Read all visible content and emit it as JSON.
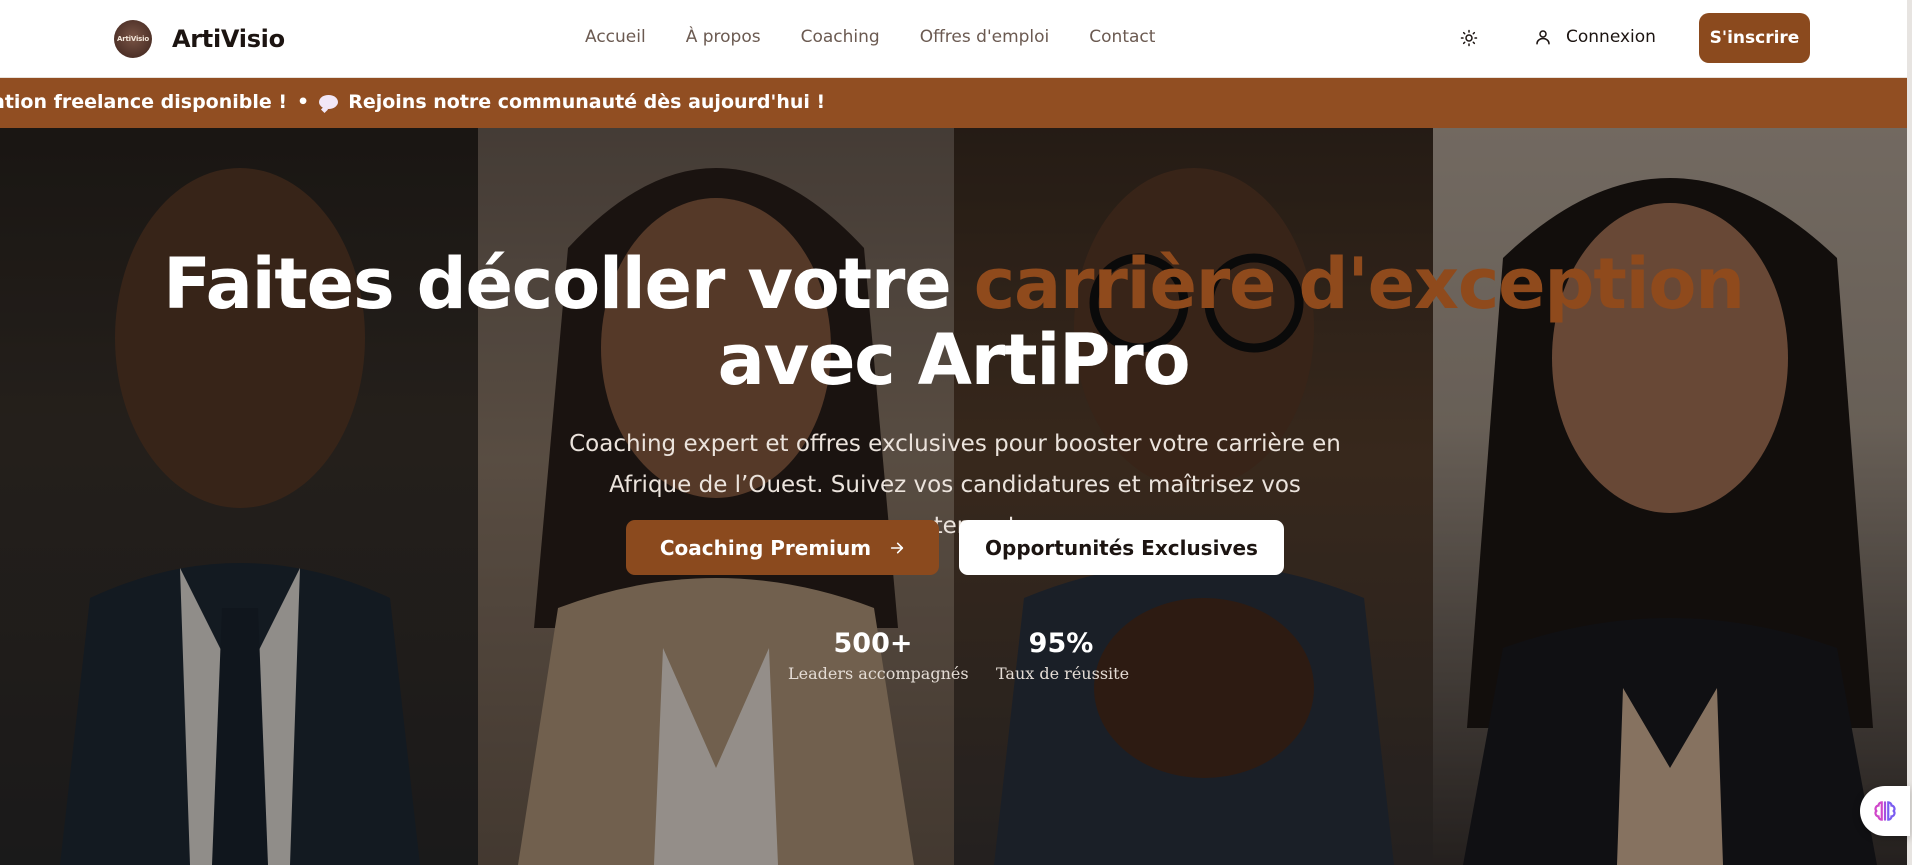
{
  "brand": {
    "logo_text": "ArtiVisio",
    "name": "ArtiVisio"
  },
  "nav": {
    "links": [
      "Accueil",
      "À propos",
      "Coaching",
      "Offres d'emploi",
      "Contact"
    ],
    "login_label": "Connexion",
    "signup_label": "S'inscrire",
    "theme_icon": "sun-icon",
    "login_icon": "user-icon"
  },
  "ticker": {
    "item_1": "ation freelance disponible !",
    "separator": "•",
    "item_2": "Rejoins notre communauté dès aujourd'hui !",
    "item_2_icon": "speech-bubble-icon"
  },
  "hero": {
    "title_part_1": "Faites décoller votre",
    "title_accent": "carrière d'exception",
    "title_part_2": "avec ArtiPro",
    "subtitle": "Coaching expert et offres exclusives pour booster votre carrière en Afrique de l’Ouest. Suivez vos candidatures et maîtrisez vos recrutements.",
    "cta_primary": "Coaching Premium",
    "cta_primary_icon": "arrow-right-icon",
    "cta_secondary": "Opportunités Exclusives",
    "stats": [
      {
        "value": "500+",
        "label": "Leaders accompagnés"
      },
      {
        "value": "95%",
        "label": "Taux de réussite"
      }
    ]
  },
  "colors": {
    "accent": "#8b4a1e",
    "ticker_bg": "#914e22",
    "text_dark": "#1c1411"
  },
  "floating": {
    "ai_icon": "brain-icon"
  }
}
